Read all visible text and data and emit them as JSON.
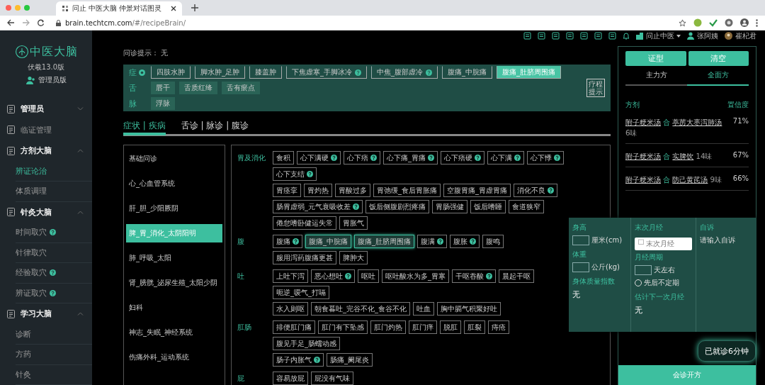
{
  "browser": {
    "tab_title": "问止 中医大脑 仲景对话图灵",
    "url_host": "brain.techtcm.com",
    "url_path": "/#/recipeBrain/"
  },
  "header": {
    "org": "问止中医",
    "patient": "张阿姨",
    "doctor": "崔杞君"
  },
  "sidebar": {
    "logo": "中医大脑",
    "version": "伏羲13.0版",
    "role": "管理员版",
    "items": [
      {
        "label": "管理员",
        "kind": "section",
        "expanded": false
      },
      {
        "label": "临证管理",
        "kind": "link"
      },
      {
        "label": "方剂大脑",
        "kind": "section",
        "expanded": true
      },
      {
        "label": "辨证论治",
        "kind": "item",
        "selected": true,
        "help": false
      },
      {
        "label": "体质调理",
        "kind": "item",
        "selected": false,
        "help": false
      },
      {
        "label": "针灸大脑",
        "kind": "section",
        "expanded": true
      },
      {
        "label": "时间取穴",
        "kind": "item",
        "selected": false,
        "help": true
      },
      {
        "label": "针律取穴",
        "kind": "item",
        "selected": false,
        "help": false
      },
      {
        "label": "经验取穴",
        "kind": "item",
        "selected": false,
        "help": true
      },
      {
        "label": "辨证取穴",
        "kind": "item",
        "selected": false,
        "help": true
      },
      {
        "label": "学习大脑",
        "kind": "section",
        "expanded": true
      },
      {
        "label": "诊断",
        "kind": "item",
        "selected": false,
        "help": false
      },
      {
        "label": "方药",
        "kind": "item",
        "selected": false,
        "help": false
      },
      {
        "label": "针灸",
        "kind": "item",
        "selected": false,
        "help": false
      }
    ]
  },
  "hint": {
    "label": "问诊提示：",
    "value": "无"
  },
  "findings": {
    "rows": [
      {
        "label": "症",
        "tags": [
          {
            "text": "四肢水肿",
            "help": false,
            "selected": false
          },
          {
            "text": "脚水肿_足肿",
            "help": false,
            "selected": false
          },
          {
            "text": "膝盖肿",
            "help": false,
            "selected": false
          },
          {
            "text": "下焦虚寒_手脚冰冷",
            "help": true,
            "selected": false
          },
          {
            "text": "中焦_腹部虚冷",
            "help": true,
            "selected": false
          },
          {
            "text": "腹痛_中脘痛",
            "help": false,
            "selected": false
          },
          {
            "text": "腹痛_肚脐周围痛",
            "help": false,
            "selected": true
          }
        ]
      },
      {
        "label": "舌",
        "tags": [
          {
            "text": "唇干",
            "help": false,
            "selected": false
          },
          {
            "text": "舌质红绛",
            "help": false,
            "selected": false
          },
          {
            "text": "舌有瘀点",
            "help": false,
            "selected": false
          }
        ]
      },
      {
        "label": "脉",
        "tags": [
          {
            "text": "浮脉",
            "help": false,
            "selected": false
          }
        ]
      }
    ],
    "course_button": "疗程提示"
  },
  "tabs": [
    {
      "label": "症状 | 疾病",
      "selected": true
    },
    {
      "label": "舌诊 | 脉诊 | 腹诊",
      "selected": false
    }
  ],
  "categories": [
    {
      "label": "基础问诊",
      "selected": false
    },
    {
      "label": "心_心血管系统",
      "selected": false
    },
    {
      "label": "肝_胆_少阳厥阴",
      "selected": false
    },
    {
      "label": "脾_胃_消化_太阴阳明",
      "selected": true
    },
    {
      "label": "肺_呼吸_太阳",
      "selected": false
    },
    {
      "label": "肾_膀胱_泌尿生殖_太阳少阴",
      "selected": false
    },
    {
      "label": "妇科",
      "selected": false
    },
    {
      "label": "神志_失眠_神经系统",
      "selected": false
    },
    {
      "label": "伤痛外科_运动系统",
      "selected": false
    }
  ],
  "groups": [
    {
      "label": "胃及消化",
      "lines": [
        [
          {
            "text": "食积",
            "help": false,
            "selected": false
          },
          {
            "text": "心下满硬",
            "help": true,
            "selected": false
          },
          {
            "text": "心下痞",
            "help": true,
            "selected": false
          },
          {
            "text": "心下痛_胃痛",
            "help": true,
            "selected": false
          },
          {
            "text": "心下痞硬",
            "help": true,
            "selected": false
          },
          {
            "text": "心下满",
            "help": true,
            "selected": false
          },
          {
            "text": "心下悸",
            "help": true,
            "selected": false
          },
          {
            "text": "心下支结",
            "help": true,
            "selected": false
          }
        ],
        [
          {
            "text": "胃痉挛",
            "help": false,
            "selected": false
          },
          {
            "text": "胃灼热",
            "help": false,
            "selected": false
          },
          {
            "text": "胃酸过多",
            "help": false,
            "selected": false
          },
          {
            "text": "胃弛缓_食后胃胀痛",
            "help": false,
            "selected": false
          },
          {
            "text": "空腹胃痛_胃虚胃痛",
            "help": false,
            "selected": false
          },
          {
            "text": "消化不良",
            "help": true,
            "selected": false
          }
        ],
        [
          {
            "text": "肠胃虚弱_元气衰吸收差",
            "help": true,
            "selected": false
          },
          {
            "text": "饭后侧腹剧烈疼痛",
            "help": false,
            "selected": false
          },
          {
            "text": "胃肠强健",
            "help": false,
            "selected": false
          },
          {
            "text": "饭后嗜睡",
            "help": false,
            "selected": false
          },
          {
            "text": "食道狭窄",
            "help": false,
            "selected": false
          },
          {
            "text": "倦怠嗜卧健运失常",
            "help": false,
            "selected": false
          },
          {
            "text": "胃胀气",
            "help": false,
            "selected": false
          }
        ]
      ]
    },
    {
      "label": "腹",
      "lines": [
        [
          {
            "text": "腹痛",
            "help": true,
            "selected": false
          },
          {
            "text": "腹痛_中脘痛",
            "help": false,
            "selected": true
          },
          {
            "text": "腹痛_肚脐周围痛",
            "help": false,
            "selected": true
          },
          {
            "text": "腹满",
            "help": true,
            "selected": false
          },
          {
            "text": "腹胀",
            "help": true,
            "selected": false
          },
          {
            "text": "腹鸣",
            "help": false,
            "selected": false
          },
          {
            "text": "服用泻药腹痛更甚",
            "help": false,
            "selected": false
          },
          {
            "text": "脾肿大",
            "help": false,
            "selected": false
          }
        ]
      ]
    },
    {
      "label": "吐",
      "lines": [
        [
          {
            "text": "上吐下泻",
            "help": false,
            "selected": false
          },
          {
            "text": "恶心想吐",
            "help": true,
            "selected": false
          },
          {
            "text": "呕吐",
            "help": false,
            "selected": false
          },
          {
            "text": "呕吐酸水为多_胃寒",
            "help": false,
            "selected": false
          },
          {
            "text": "干呕吞酸",
            "help": true,
            "selected": false
          },
          {
            "text": "晨起干呕",
            "help": false,
            "selected": false
          },
          {
            "text": "呃逆_嗳气_打嗝",
            "help": false,
            "selected": false
          }
        ],
        [
          {
            "text": "水入则呕",
            "help": false,
            "selected": false
          },
          {
            "text": "朝食暮吐_完谷不化_食谷不化",
            "help": false,
            "selected": false
          },
          {
            "text": "吐血",
            "help": false,
            "selected": false
          },
          {
            "text": "胸中膈气积聚好吐",
            "help": false,
            "selected": false
          }
        ]
      ]
    },
    {
      "label": "肛肠",
      "lines": [
        [
          {
            "text": "排便肛门痛",
            "help": false,
            "selected": false
          },
          {
            "text": "肛门有下坠感",
            "help": false,
            "selected": false
          },
          {
            "text": "肛门灼热",
            "help": false,
            "selected": false
          },
          {
            "text": "肛门痒",
            "help": false,
            "selected": false
          },
          {
            "text": "脱肛",
            "help": false,
            "selected": false
          },
          {
            "text": "肛裂",
            "help": false,
            "selected": false
          },
          {
            "text": "痔疮",
            "help": false,
            "selected": false
          },
          {
            "text": "腹见手足_肠蠕动感",
            "help": false,
            "selected": false
          }
        ],
        [
          {
            "text": "肠子内胀气",
            "help": true,
            "selected": false
          },
          {
            "text": "肠痛_阑尾炎",
            "help": false,
            "selected": false
          }
        ]
      ]
    },
    {
      "label": "屁",
      "lines": [
        [
          {
            "text": "容易放屁",
            "help": false,
            "selected": false
          },
          {
            "text": "屁没有气味",
            "help": false,
            "selected": false
          }
        ]
      ]
    }
  ],
  "side": {
    "buttons": [
      "证型",
      "清空"
    ],
    "tabs": [
      {
        "label": "主力方",
        "selected": false
      },
      {
        "label": "全面方",
        "selected": true
      }
    ],
    "col_formula": "方剂",
    "col_confidence": "置信度",
    "formulas": [
      {
        "first": "附子粳米汤",
        "join": "合",
        "second": "葶苈大枣泻肺汤",
        "count": "6味",
        "confidence": "71%"
      },
      {
        "first": "附子粳米汤",
        "join": "合",
        "second": "实脾饮",
        "count": "14味",
        "confidence": "67%"
      },
      {
        "first": "附子粳米汤",
        "join": "合",
        "second": "防己黄芪汤",
        "count": "9味",
        "confidence": "66%"
      }
    ],
    "submit": "会诊开方"
  },
  "popup": {
    "height_label": "身高",
    "height_unit": "厘米(cm)",
    "weight_label": "体重",
    "weight_unit": "公斤(kg)",
    "bmi_label": "身体质量指数",
    "bmi_value": "无",
    "lmp_label": "末次月经",
    "lmp_placeholder": "末次月经",
    "cycle_label": "月经周期",
    "cycle_unit": "天左右",
    "irregular": {
      "label": "先后不定期",
      "checked": false
    },
    "next_label": "估计下一次月经",
    "next_value": "无",
    "complaint_label": "自诉",
    "complaint_placeholder": "请输入自诉"
  },
  "timer": "已就诊6分钟"
}
